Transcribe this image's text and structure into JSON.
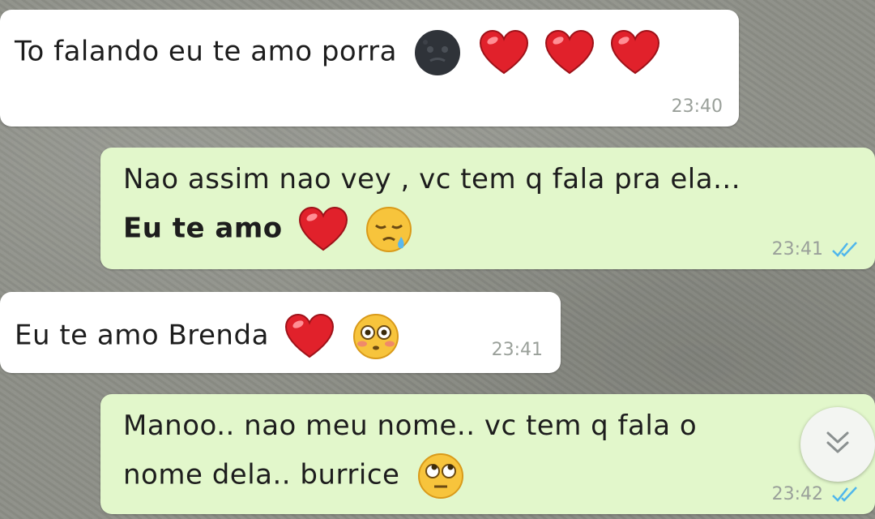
{
  "messages": [
    {
      "direction": "incoming",
      "lines": [
        "To falando eu te amo porra"
      ],
      "emojis": [
        "new-moon-face-emoji",
        "red-heart-emoji",
        "red-heart-emoji",
        "red-heart-emoji"
      ],
      "time": "23:40"
    },
    {
      "direction": "outgoing",
      "lines": [
        "Nao assim nao vey , vc tem q fala pra ela...",
        "Eu te amo"
      ],
      "emojis": [
        "red-heart-emoji",
        "sleepy-face-emoji"
      ],
      "time": "23:41",
      "status": "read"
    },
    {
      "direction": "incoming",
      "lines": [
        "Eu te amo Brenda"
      ],
      "emojis": [
        "red-heart-emoji",
        "flushed-face-emoji"
      ],
      "time": "23:41"
    },
    {
      "direction": "outgoing",
      "lines": [
        "Manoo.. nao meu nome.. vc tem q fala o",
        "nome dela.. burrice"
      ],
      "emojis": [
        "rolling-eyes-emoji"
      ],
      "time": "23:42",
      "status": "read"
    }
  ],
  "colors": {
    "incoming_bubble": "#ffffff",
    "outgoing_bubble": "#e2f7cb",
    "timestamp": "#9aa09a",
    "read_ticks": "#4fb6ec"
  },
  "icons": {
    "scroll_down": "double-chevron-down-icon"
  }
}
